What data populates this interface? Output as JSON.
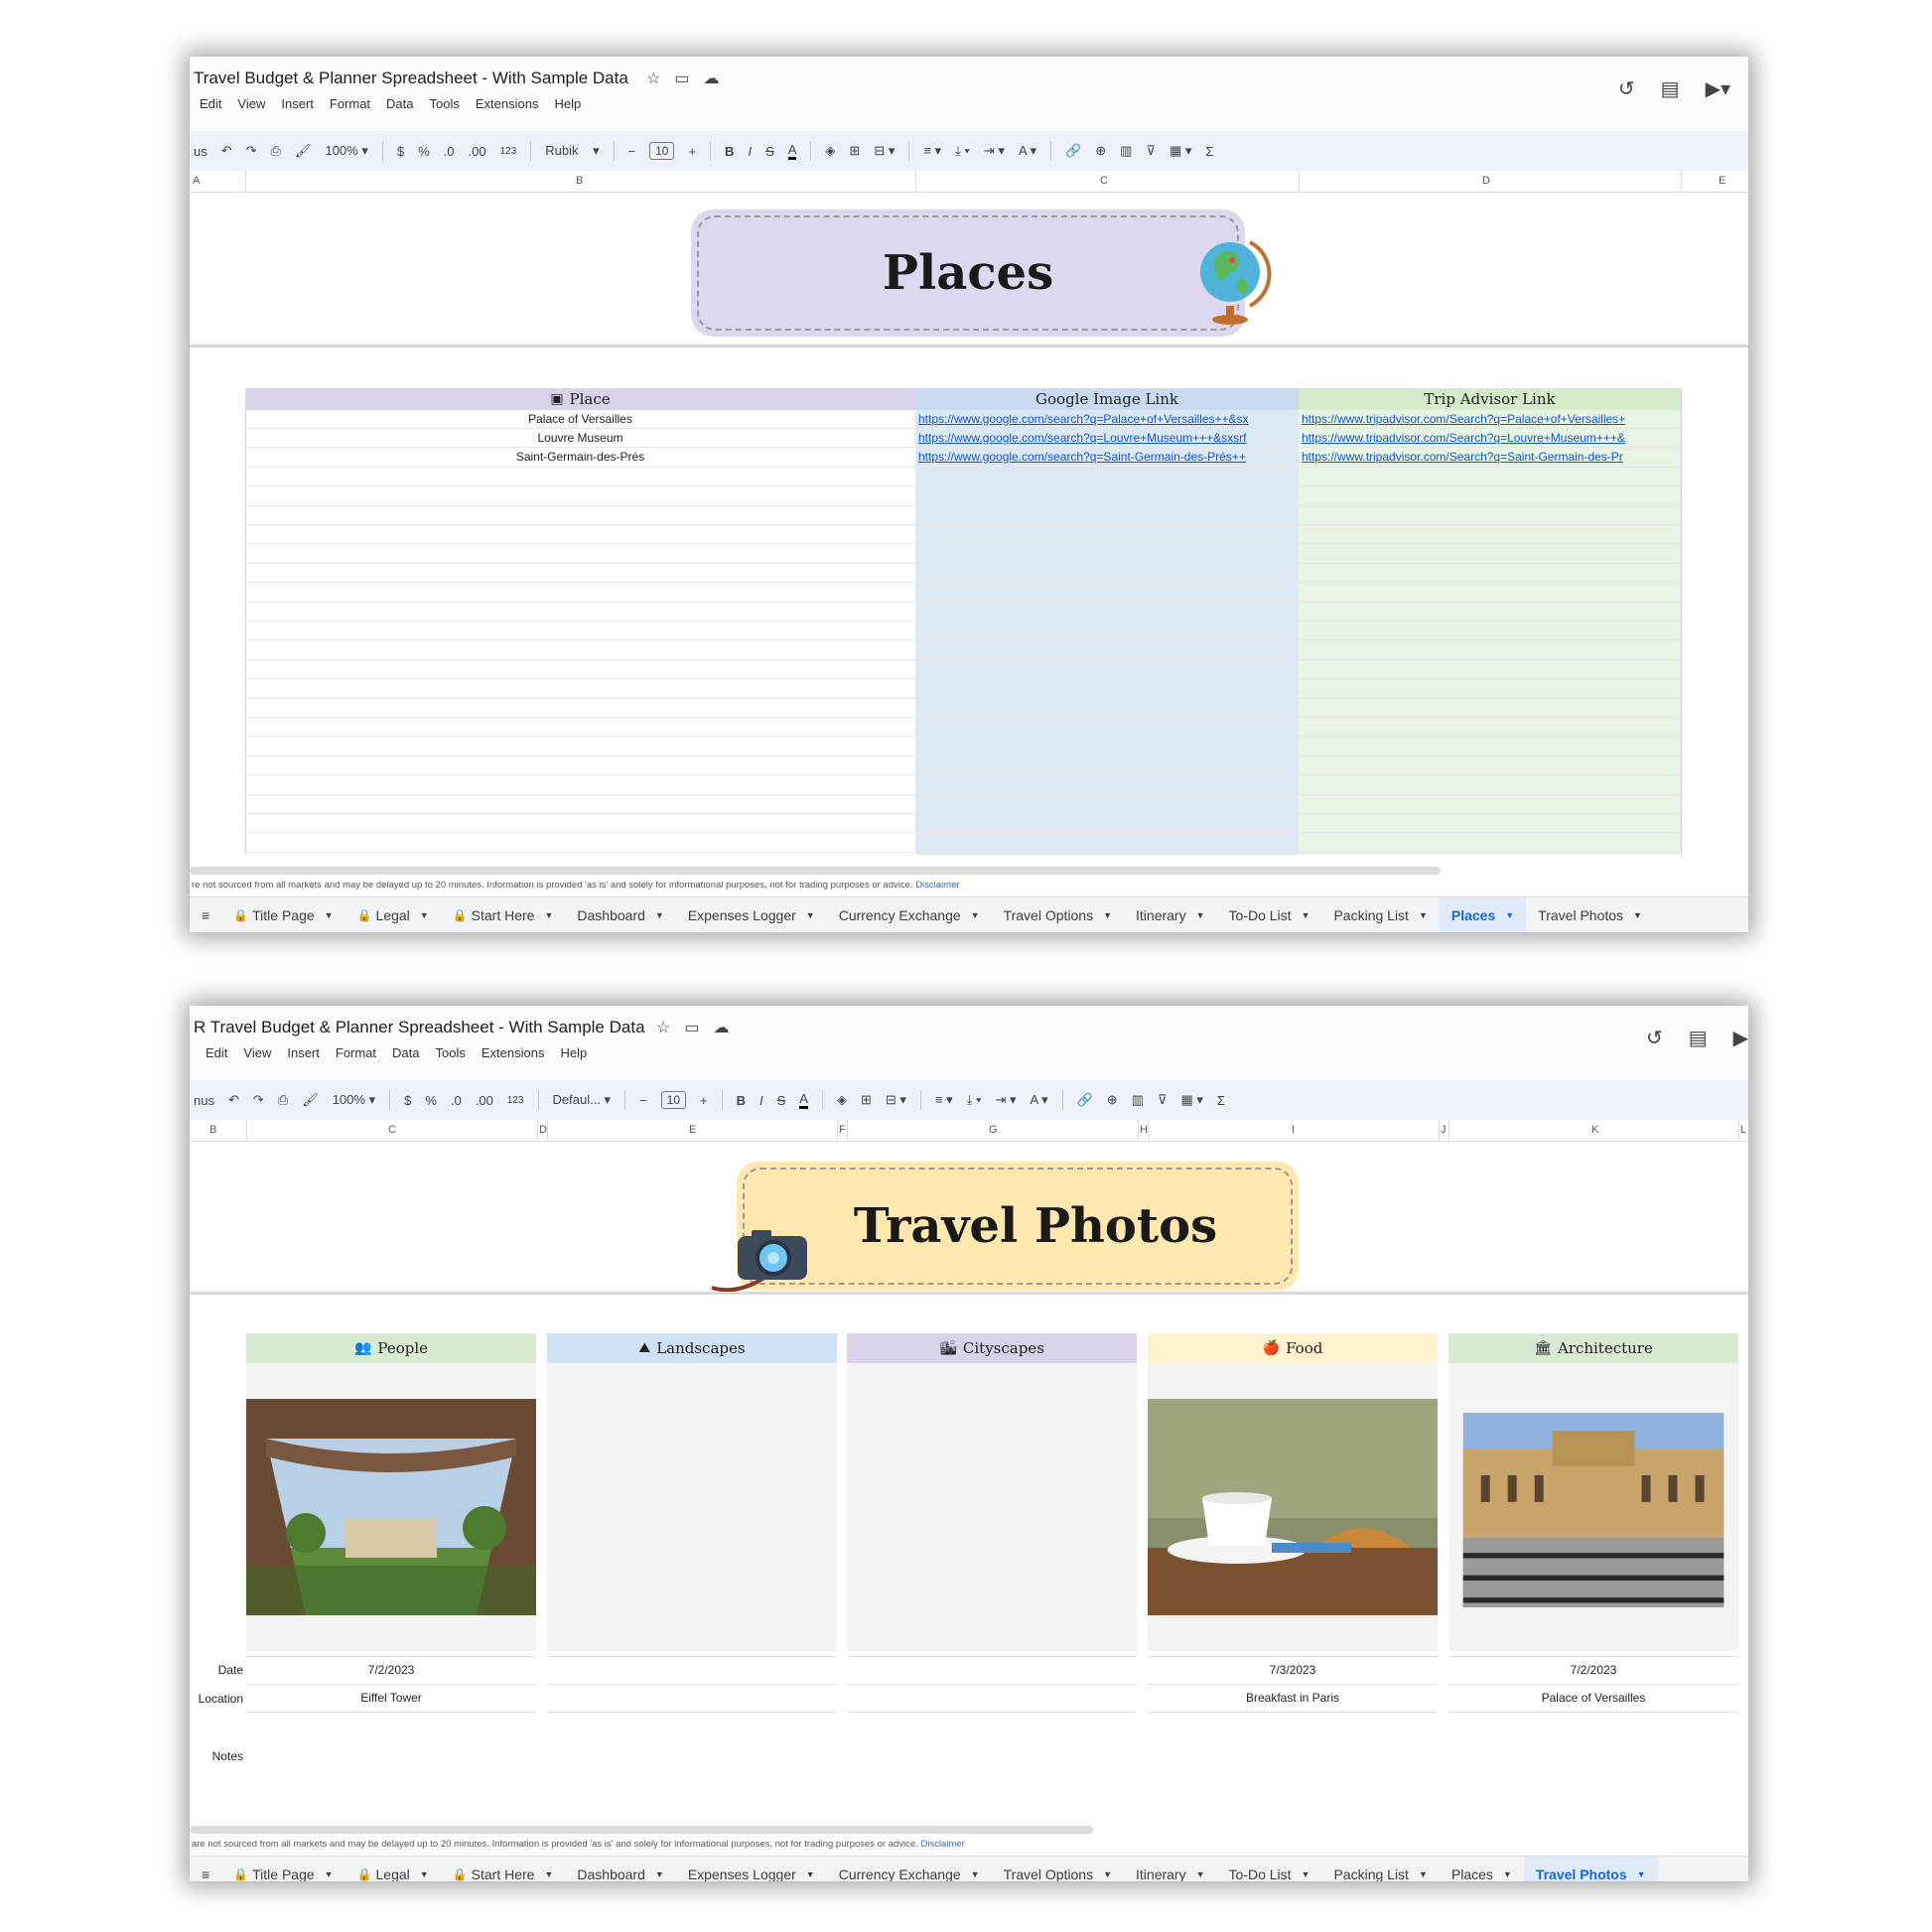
{
  "doc_title": "Travel Budget & Planner Spreadsheet - With Sample Data",
  "menu": [
    "Edit",
    "View",
    "Insert",
    "Format",
    "Data",
    "Tools",
    "Extensions",
    "Help"
  ],
  "toolbar": {
    "search_stub_1": "us",
    "search_stub_2": "nus",
    "zoom": "100%",
    "currency": "$",
    "percent": "%",
    "dec_less": ".0",
    "dec_more": ".00",
    "num_fmt": "123",
    "font_1": "Rubik",
    "font_2": "Defaul...",
    "font_size": "10",
    "bold": "B",
    "italic": "I",
    "strike": "S",
    "text_color": "A",
    "sum": "Σ"
  },
  "places": {
    "columns_letters": [
      "A",
      "B",
      "C",
      "D",
      "E"
    ],
    "banner_title": "Places",
    "headers": {
      "place": "Place",
      "google": "Google Image Link",
      "trip": "Trip Advisor Link"
    },
    "rows": [
      {
        "place": "Palace of Versailles",
        "google": "https://www.google.com/search?q=Palace+of+Versailles++&sx",
        "trip": "https://www.tripadvisor.com/Search?q=Palace+of+Versailles+"
      },
      {
        "place": "Louvre Museum",
        "google": "https://www.google.com/search?q=Louvre+Museum+++&sxsrf",
        "trip": "https://www.tripadvisor.com/Search?q=Louvre+Museum+++&"
      },
      {
        "place": "Saint-Germain-des-Prés",
        "google": "https://www.google.com/search?q=Saint-Germain-des-Prés++",
        "trip": "https://www.tripadvisor.com/Search?q=Saint-Germain-des-Pr"
      }
    ],
    "footer_note": "re not sourced from all markets and may be delayed up to 20 minutes. Information is provided 'as is' and solely for informational purposes, not for trading purposes or advice.",
    "disclaimer": "Disclaimer",
    "tabs": [
      "Title Page",
      "Legal",
      "Start Here",
      "Dashboard",
      "Expenses Logger",
      "Currency Exchange",
      "Travel Options",
      "Itinerary",
      "To-Do List",
      "Packing List",
      "Places",
      "Travel Photos"
    ],
    "active_tab": "Places"
  },
  "photos": {
    "doc_title_prefix": "R",
    "columns_letters": [
      "B",
      "C",
      "D",
      "E",
      "F",
      "G",
      "H",
      "I",
      "J",
      "K",
      "L"
    ],
    "banner_title": "Travel Photos",
    "categories": [
      {
        "label": "People",
        "icon": "people-icon",
        "color": "#d9ead3",
        "date": "7/2/2023",
        "location": "Eiffel Tower"
      },
      {
        "label": "Landscapes",
        "icon": "landscape-icon",
        "color": "#cfe2f3",
        "date": "",
        "location": ""
      },
      {
        "label": "Cityscapes",
        "icon": "cityscape-icon",
        "color": "#d9d2e9",
        "date": "",
        "location": ""
      },
      {
        "label": "Food",
        "icon": "food-icon",
        "color": "#fff2cc",
        "date": "7/3/2023",
        "location": "Breakfast in Paris"
      },
      {
        "label": "Architecture",
        "icon": "architecture-icon",
        "color": "#d9ead3",
        "date": "7/2/2023",
        "location": "Palace of Versailles"
      }
    ],
    "row_labels": {
      "date": "Date",
      "location": "Location",
      "notes": "Notes"
    },
    "footer_note": "are not sourced from all markets and may be delayed up to 20 minutes. Information is provided 'as is' and solely for informational purposes, not for trading purposes or advice.",
    "disclaimer": "Disclaimer",
    "tabs": [
      "Title Page",
      "Legal",
      "Start Here",
      "Dashboard",
      "Expenses Logger",
      "Currency Exchange",
      "Travel Options",
      "Itinerary",
      "To-Do List",
      "Packing List",
      "Places",
      "Travel Photos"
    ],
    "active_tab": "Travel Photos"
  },
  "colors": {
    "places_banner": "#dcd8ef",
    "photos_banner": "#ffe8b0",
    "link": "#1155cc",
    "place_col_header": "#d9d2e9",
    "google_col": "#dde8f5",
    "trip_col": "#e8f4e4"
  }
}
